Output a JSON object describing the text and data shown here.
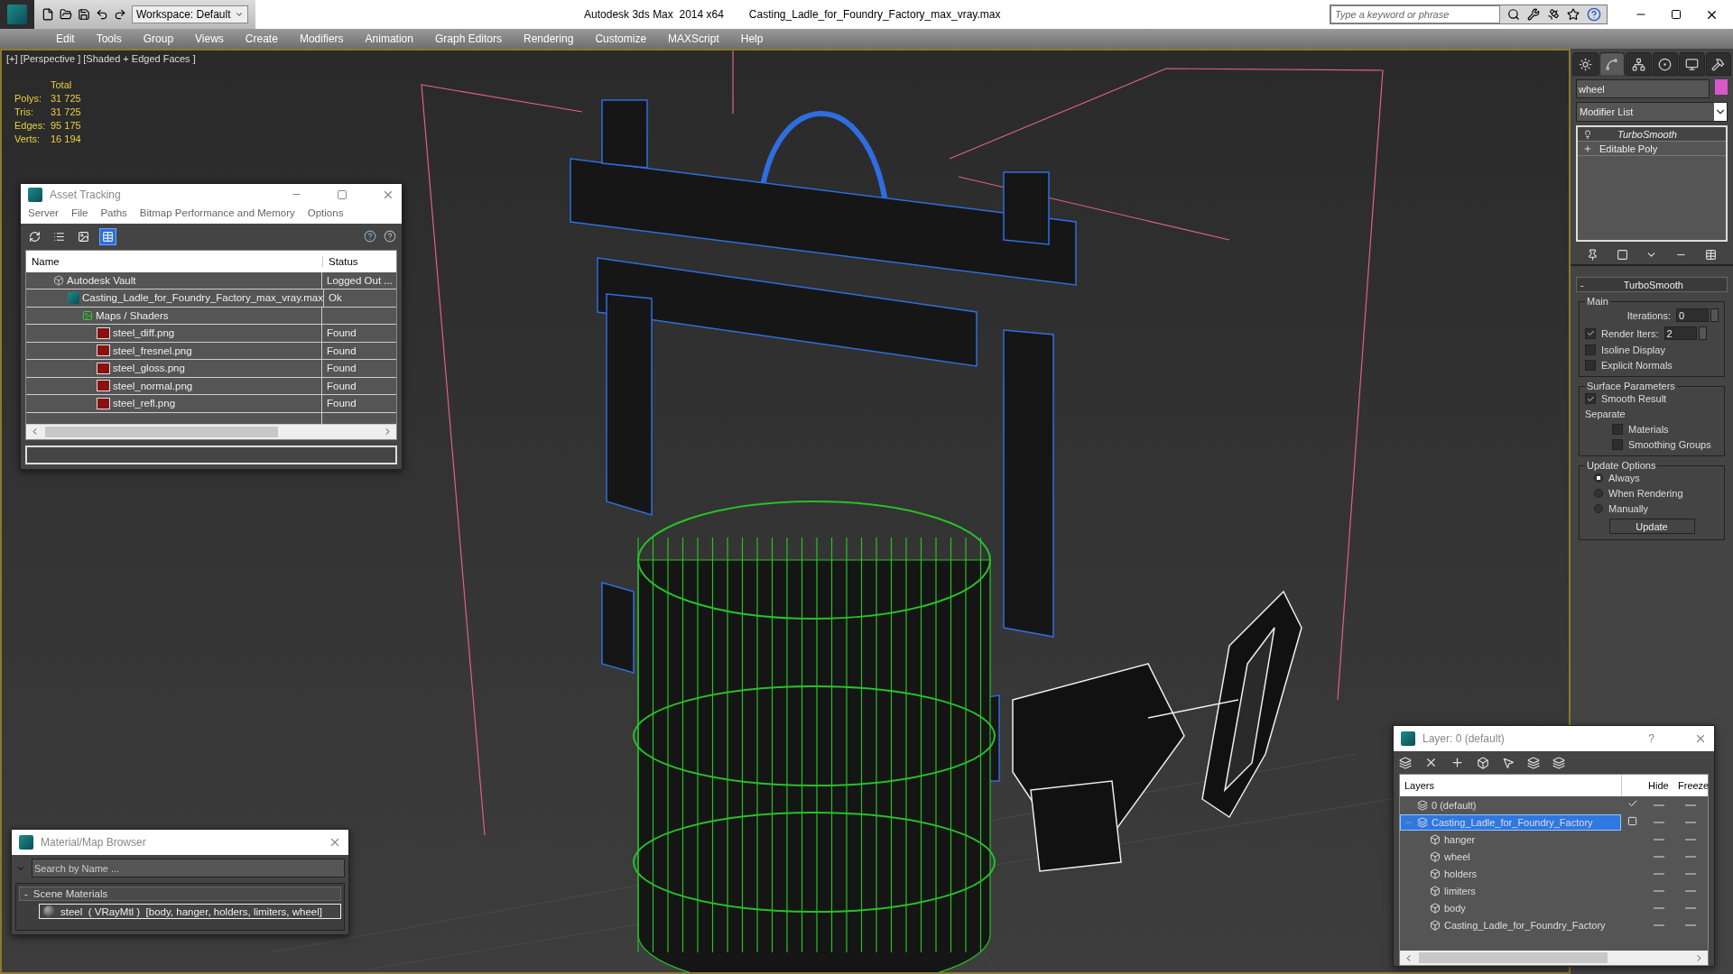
{
  "app": {
    "title": "Autodesk 3ds Max  2014 x64",
    "document": "Casting_Ladle_for_Foundry_Factory_max_vray.max",
    "workspace": "Workspace: Default",
    "search": {
      "placeholder": "Type a keyword or phrase"
    }
  },
  "menu_bar": [
    "Edit",
    "Tools",
    "Group",
    "Views",
    "Create",
    "Modifiers",
    "Animation",
    "Graph Editors",
    "Rendering",
    "Customize",
    "MAXScript",
    "Help"
  ],
  "viewport": {
    "label": "[+] [Perspective ] [Shaded + Edged Faces ]",
    "stats": {
      "header": "Total",
      "rows": [
        {
          "label": "Polys:",
          "value": "31 725"
        },
        {
          "label": "Tris:",
          "value": "31 725"
        },
        {
          "label": "Edges:",
          "value": "95 175"
        },
        {
          "label": "Verts:",
          "value": "16 194"
        }
      ]
    }
  },
  "asset_tracking": {
    "title": "Asset Tracking",
    "menu": [
      "Server",
      "File",
      "Paths",
      "Bitmap Performance and Memory",
      "Options"
    ],
    "view_buttons": [
      {
        "selected": false
      },
      {
        "selected": false
      },
      {
        "selected": false
      },
      {
        "selected": true
      }
    ],
    "columns": [
      "Name",
      "Status"
    ],
    "rows": [
      {
        "kind": "vault",
        "name": "Autodesk Vault",
        "status": "Logged Out ...",
        "children": [
          {
            "kind": "scene",
            "name": "Casting_Ladle_for_Foundry_Factory_max_vray.max",
            "status": "Ok",
            "children": [
              {
                "kind": "folder",
                "name": "Maps / Shaders",
                "children": [
                  {
                    "kind": "png",
                    "name": "steel_diff.png",
                    "status": "Found"
                  },
                  {
                    "kind": "png",
                    "name": "steel_fresnel.png",
                    "status": "Found"
                  },
                  {
                    "kind": "png",
                    "name": "steel_gloss.png",
                    "status": "Found"
                  },
                  {
                    "kind": "png",
                    "name": "steel_normal.png",
                    "status": "Found"
                  },
                  {
                    "kind": "png",
                    "name": "steel_refl.png",
                    "status": "Found"
                  }
                ]
              }
            ]
          }
        ]
      }
    ]
  },
  "material_browser": {
    "title": "Material/Map Browser",
    "search": {
      "placeholder": "Search by Name ..."
    },
    "group": {
      "toggle": "-",
      "title": "Scene Materials",
      "expanded": true
    },
    "items": [
      "steel  ( VRayMtl )  [body, hanger, holders, limiters, wheel]"
    ]
  },
  "layer_manager": {
    "title": "Layer: 0 (default)",
    "help": "?",
    "columns": [
      "Layers",
      "Hide",
      "Freeze"
    ],
    "layers": [
      {
        "name": "0 (default)",
        "current": true,
        "selected": false
      },
      {
        "name": "Casting_Ladle_for_Foundry_Factory",
        "current": false,
        "selected": true,
        "expanded": true,
        "children": [
          {
            "name": "hanger",
            "selected": false
          },
          {
            "name": "wheel",
            "selected": false
          },
          {
            "name": "holders",
            "selected": false
          },
          {
            "name": "limiters",
            "selected": false
          },
          {
            "name": "body",
            "selected": false
          },
          {
            "name": "Casting_Ladle_for_Foundry_Factory",
            "selected": false
          }
        ]
      }
    ]
  },
  "command_panel": {
    "tabs": [
      {
        "selected": false
      },
      {
        "selected": true
      },
      {
        "selected": false
      },
      {
        "selected": false
      },
      {
        "selected": false
      },
      {
        "selected": false
      }
    ],
    "object_name": "wheel",
    "modifier_list": "Modifier List",
    "stack": [
      {
        "kind": "modifier",
        "label": "TurboSmooth"
      },
      {
        "kind": "base",
        "label": "Editable Poly"
      }
    ],
    "rollout": {
      "toggle": "-",
      "title": "TurboSmooth",
      "groups": [
        {
          "title": "Main",
          "items": [
            {
              "kind": "spinner",
              "label": "Iterations:",
              "value": "0"
            },
            {
              "kind": "check_spinner",
              "label": "Render Iters:",
              "checked": true,
              "value": "2"
            },
            {
              "kind": "checkbox",
              "label": "Isoline Display",
              "checked": false
            },
            {
              "kind": "checkbox",
              "label": "Explicit Normals",
              "checked": false
            }
          ]
        },
        {
          "title": "Surface Parameters",
          "items": [
            {
              "kind": "checkbox",
              "label": "Smooth Result",
              "checked": true
            },
            {
              "kind": "label",
              "label": "Separate",
              "children": [
                {
                  "kind": "checkbox",
                  "label": "Materials",
                  "checked": false
                },
                {
                  "kind": "checkbox",
                  "label": "Smoothing Groups",
                  "checked": false
                }
              ]
            }
          ]
        },
        {
          "title": "Update Options",
          "items": [
            {
              "kind": "radio",
              "label": "Always",
              "selected": true
            },
            {
              "kind": "radio",
              "label": "When Rendering",
              "selected": false
            },
            {
              "kind": "radio",
              "label": "Manually",
              "selected": false
            },
            {
              "kind": "button",
              "label": "Update"
            }
          ]
        }
      ]
    }
  }
}
